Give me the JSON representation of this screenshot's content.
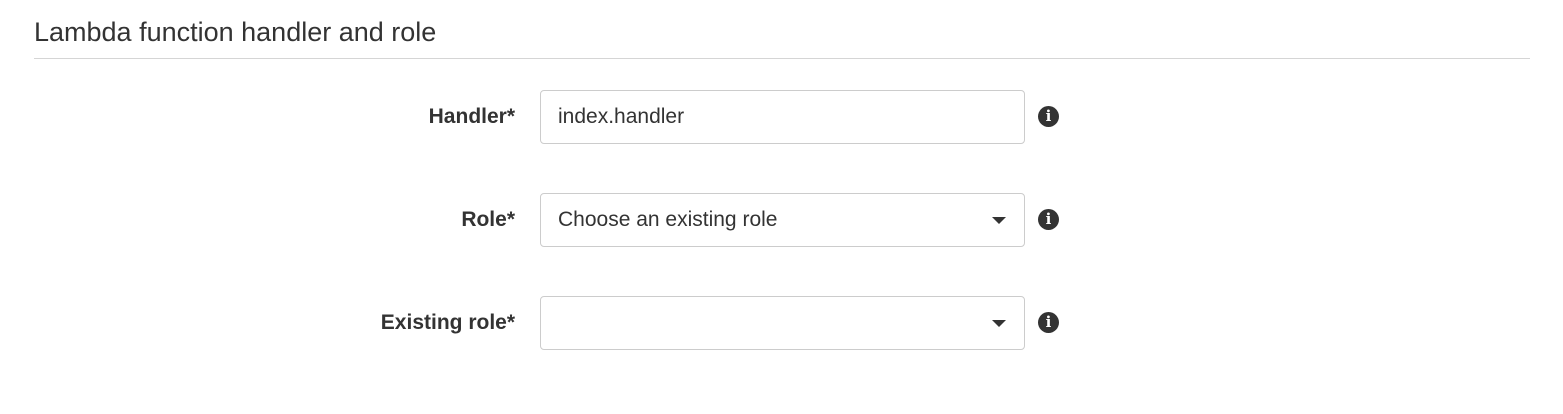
{
  "section": {
    "title": "Lambda function handler and role"
  },
  "fields": {
    "handler": {
      "label": "Handler*",
      "value": "index.handler",
      "info_icon": "info-icon",
      "info_glyph": "i"
    },
    "role": {
      "label": "Role*",
      "selected": "Choose an existing role",
      "dropdown_icon": "caret-down-icon",
      "info_icon": "info-icon",
      "info_glyph": "i"
    },
    "existing_role": {
      "label": "Existing role*",
      "selected": "",
      "dropdown_icon": "caret-down-icon",
      "info_icon": "info-icon",
      "info_glyph": "i"
    }
  }
}
